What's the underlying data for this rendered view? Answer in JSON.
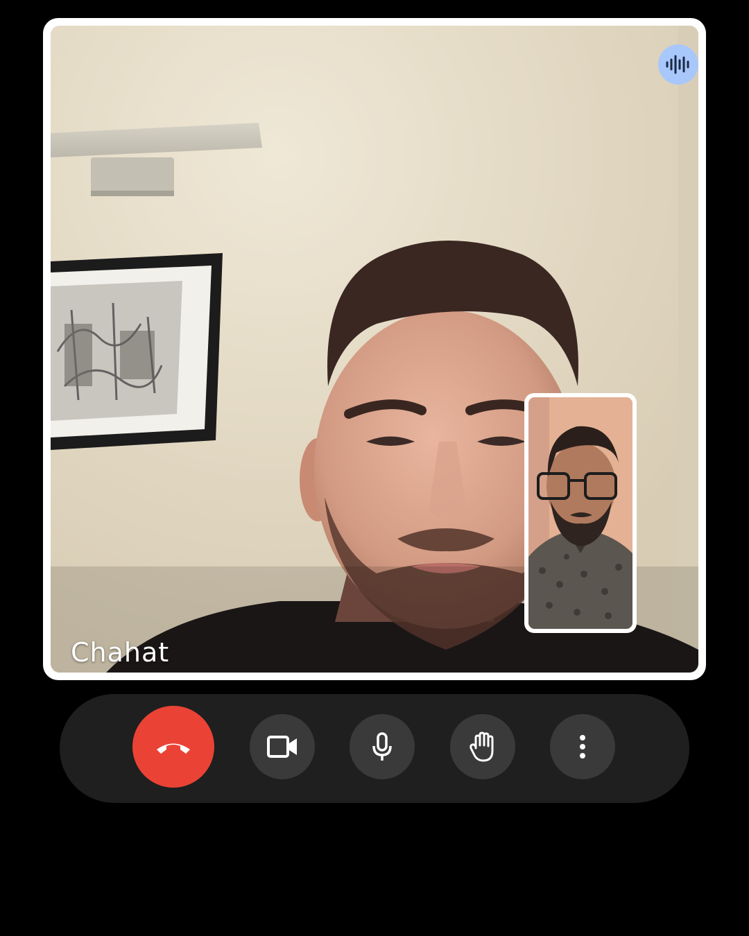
{
  "call": {
    "participant_name": "Chahat",
    "speaking_indicator_icon": "audio-waveform-icon",
    "speaking_indicator_color": "#a8c7fa"
  },
  "controls": [
    {
      "name": "end-call-button",
      "icon": "phone-hangup-icon",
      "color": "#ea4335"
    },
    {
      "name": "camera-button",
      "icon": "video-camera-icon",
      "color": "#3a3a3a"
    },
    {
      "name": "microphone-button",
      "icon": "microphone-icon",
      "color": "#3a3a3a"
    },
    {
      "name": "raise-hand-button",
      "icon": "hand-icon",
      "color": "#3a3a3a"
    },
    {
      "name": "more-options-button",
      "icon": "more-vertical-icon",
      "color": "#3a3a3a"
    }
  ]
}
